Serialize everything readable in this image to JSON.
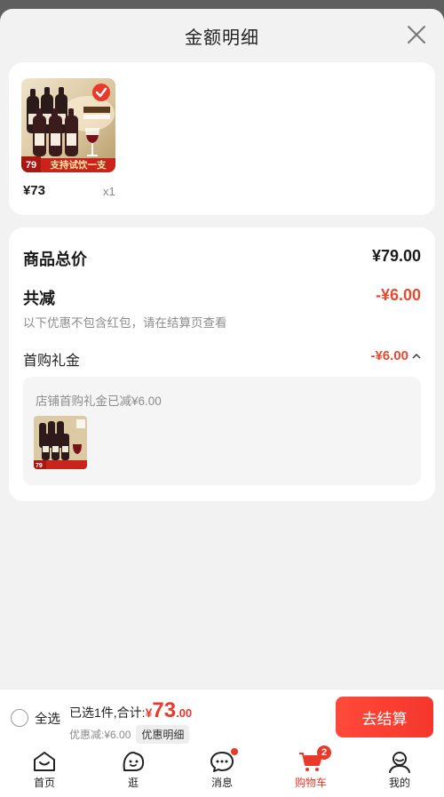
{
  "sheet": {
    "title": "金额明细"
  },
  "items": [
    {
      "price": "¥73",
      "qty": "x1",
      "badge_price": "79",
      "badge_text": "支持试饮一支",
      "selected": true
    }
  ],
  "summary": {
    "total_label": "商品总价",
    "total_value": "¥79.00",
    "reduce_label": "共减",
    "reduce_value": "-¥6.00",
    "note": "以下优惠不包含红包，请在结算页查看",
    "gift_label": "首购礼金",
    "gift_value": "-¥6.00",
    "gift_detail": "店铺首购礼金已减¥6.00"
  },
  "bottom_bar": {
    "select_all": "全选",
    "selected_text": "已选1件,合计:",
    "currency": "¥",
    "amount_int": "73",
    "amount_dec": ".00",
    "discount": "优惠减:¥6.00",
    "detail_chip": "优惠明细",
    "checkout": "去结算"
  },
  "tabbar": [
    {
      "label": "首页",
      "icon": "home-icon"
    },
    {
      "label": "逛",
      "icon": "browse-icon"
    },
    {
      "label": "消息",
      "icon": "message-icon",
      "dot": true
    },
    {
      "label": "购物车",
      "icon": "cart-icon",
      "badge": "2",
      "active": true
    },
    {
      "label": "我的",
      "icon": "profile-icon"
    }
  ],
  "colors": {
    "accent": "#e8392b",
    "background": "#f2f2f2",
    "card": "#ffffff"
  }
}
